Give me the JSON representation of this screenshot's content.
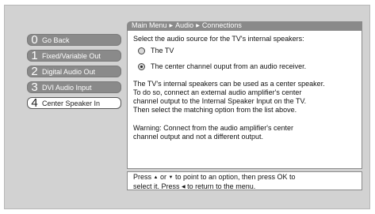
{
  "breadcrumb": {
    "root": "Main Menu",
    "section": "Audio",
    "page": "Connections"
  },
  "nav": [
    {
      "num": "0",
      "label": "Go Back",
      "selected": false
    },
    {
      "num": "1",
      "label": "Fixed/Variable Out",
      "selected": false
    },
    {
      "num": "2",
      "label": "Digital Audio Out",
      "selected": false
    },
    {
      "num": "3",
      "label": "DVI Audio Input",
      "selected": false
    },
    {
      "num": "4",
      "label": "Center Speaker In",
      "selected": true
    }
  ],
  "content": {
    "prompt": "Select the audio source for the TV's internal speakers:",
    "options": [
      {
        "label": "The TV",
        "checked": false
      },
      {
        "label": "The center channel ouput from an audio receiver.",
        "checked": true
      }
    ],
    "info_lines": [
      "The TV's internal speakers can be used as a center speaker.",
      "To do so, connect an external audio amplifier's center",
      "channel output to the Internal Speaker Input on the TV.",
      "Then select the matching option from the list above."
    ],
    "warning_lines": [
      "Warning: Connect from the audio amplifier's center",
      "channel output and not a different output."
    ]
  },
  "help": {
    "line1_a": "Press ",
    "line1_b": " or ",
    "line1_c": " to point to an option, then press OK to",
    "line2_a": "select it. Press ",
    "line2_b": " to return to the menu.",
    "up_icon": "up-triangle",
    "down_icon": "down-triangle",
    "left_icon": "left-triangle"
  }
}
